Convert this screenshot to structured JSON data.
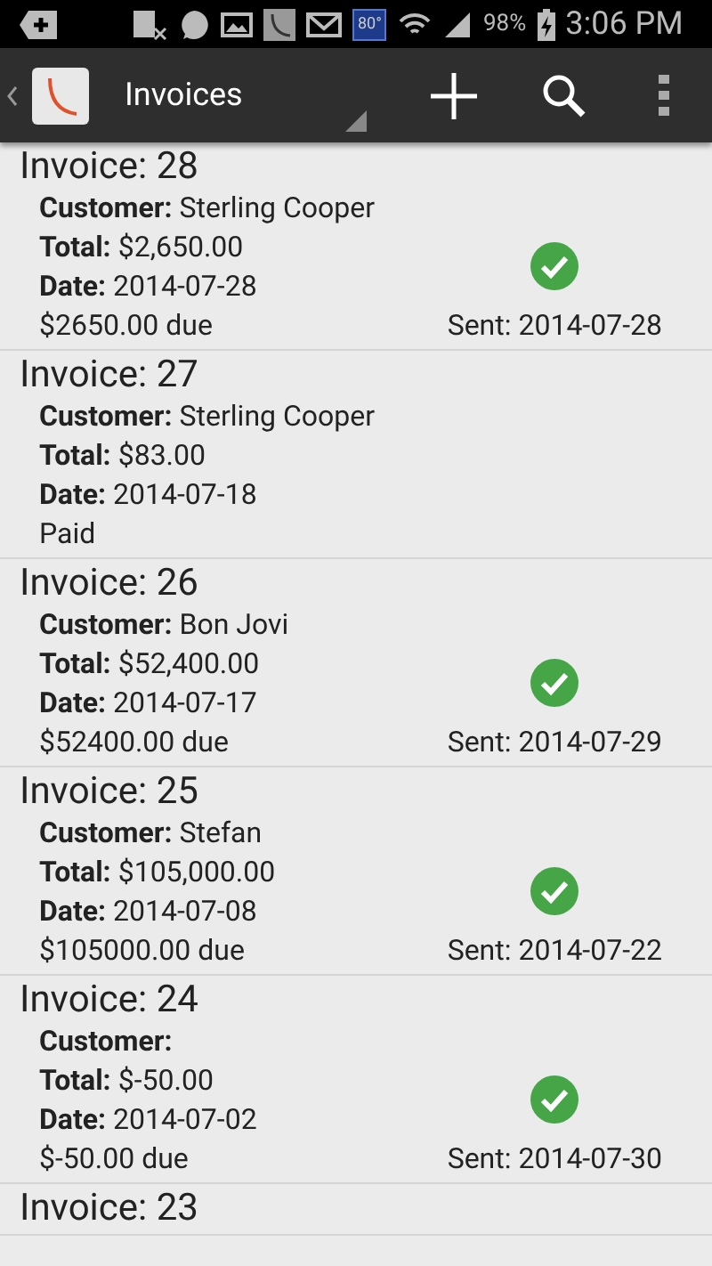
{
  "status_bar": {
    "temperature": "80°",
    "battery": "98%",
    "time": "3:06 PM"
  },
  "action_bar": {
    "title": "Invoices"
  },
  "invoices": [
    {
      "title": "Invoice: 28",
      "fields": [
        {
          "label": "Customer:",
          "value": "Sterling Cooper"
        },
        {
          "label": "Total:",
          "value": "$2,650.00"
        },
        {
          "label": "Date:",
          "value": "2014-07-28"
        }
      ],
      "status": "$2650.00 due",
      "sent": true,
      "sent_text": "Sent: 2014-07-28"
    },
    {
      "title": "Invoice: 27",
      "fields": [
        {
          "label": "Customer:",
          "value": "Sterling Cooper"
        },
        {
          "label": "Total:",
          "value": "$83.00"
        },
        {
          "label": "Date:",
          "value": "2014-07-18"
        }
      ],
      "status": "Paid",
      "sent": false
    },
    {
      "title": "Invoice: 26",
      "fields": [
        {
          "label": "Customer:",
          "value": "Bon Jovi"
        },
        {
          "label": "Total:",
          "value": "$52,400.00"
        },
        {
          "label": "Date:",
          "value": "2014-07-17"
        }
      ],
      "status": "$52400.00 due",
      "sent": true,
      "sent_text": "Sent: 2014-07-29"
    },
    {
      "title": "Invoice: 25",
      "fields": [
        {
          "label": "Customer:",
          "value": "Stefan"
        },
        {
          "label": "Total:",
          "value": "$105,000.00"
        },
        {
          "label": "Date:",
          "value": "2014-07-08"
        }
      ],
      "status": "$105000.00 due",
      "sent": true,
      "sent_text": "Sent: 2014-07-22"
    },
    {
      "title": "Invoice: 24",
      "fields": [
        {
          "label": "Customer:"
        },
        {
          "label": "Total:",
          "value": "$-50.00"
        },
        {
          "label": "Date:",
          "value": "2014-07-02"
        }
      ],
      "status": "$-50.00 due",
      "sent": true,
      "sent_text": "Sent: 2014-07-30"
    },
    {
      "title": "Invoice: 23"
    }
  ]
}
